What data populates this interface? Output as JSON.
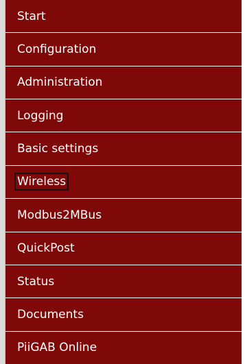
{
  "menu": {
    "active": "Wireless",
    "items": [
      {
        "label": "Start"
      },
      {
        "label": "Configuration"
      },
      {
        "label": "Administration"
      },
      {
        "label": "Logging"
      },
      {
        "label": "Basic settings"
      },
      {
        "label": "Wireless"
      },
      {
        "label": "Modbus2MBus"
      },
      {
        "label": "QuickPost"
      },
      {
        "label": "Status"
      },
      {
        "label": "Documents"
      },
      {
        "label": "PiiGAB Online"
      }
    ]
  },
  "colors": {
    "menu_background": "#7f0808",
    "menu_text": "#ffffff",
    "separator": "#ffffff",
    "left_rule": "#dcdcdc",
    "active_outline": "#141414"
  }
}
